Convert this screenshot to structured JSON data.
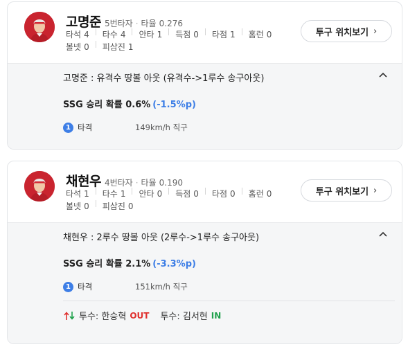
{
  "colors": {
    "accent_blue": "#3d7ee6",
    "out_red": "#e0302e",
    "in_green": "#1fa14c",
    "detail_bg": "#f5f6f7",
    "team_red": "#c9242f"
  },
  "players": [
    {
      "name": "고명준",
      "order": "5번타자",
      "avg_label": "타율",
      "avg": "0.276",
      "stats_row1": [
        {
          "label": "타석",
          "value": "4"
        },
        {
          "label": "타수",
          "value": "4"
        },
        {
          "label": "안타",
          "value": "1"
        },
        {
          "label": "득점",
          "value": "0"
        },
        {
          "label": "타점",
          "value": "1"
        },
        {
          "label": "홈런",
          "value": "0"
        }
      ],
      "stats_row2": [
        {
          "label": "볼넷",
          "value": "0"
        },
        {
          "label": "피삼진",
          "value": "1"
        }
      ],
      "pitch_button": "투구 위치보기",
      "play_desc": "고명준 : 유격수 땅볼 아웃 (유격수->1루수 송구아웃)",
      "prob_text": "SSG 승리 확률 0.6%",
      "prob_delta": "(-1.5%p)",
      "pitch_no": "1",
      "pitch_result": "타격",
      "pitch_info": "149km/h 직구"
    },
    {
      "name": "채현우",
      "order": "4번타자",
      "avg_label": "타율",
      "avg": "0.190",
      "stats_row1": [
        {
          "label": "타석",
          "value": "1"
        },
        {
          "label": "타수",
          "value": "1"
        },
        {
          "label": "안타",
          "value": "0"
        },
        {
          "label": "득점",
          "value": "0"
        },
        {
          "label": "타점",
          "value": "0"
        },
        {
          "label": "홈런",
          "value": "0"
        }
      ],
      "stats_row2": [
        {
          "label": "볼넷",
          "value": "0"
        },
        {
          "label": "피삼진",
          "value": "0"
        }
      ],
      "pitch_button": "투구 위치보기",
      "play_desc": "채현우 : 2루수 땅볼 아웃 (2루수->1루수 송구아웃)",
      "prob_text": "SSG 승리 확률 2.1%",
      "prob_delta": "(-3.3%p)",
      "pitch_no": "1",
      "pitch_result": "타격",
      "pitch_info": "151km/h 직구",
      "substitution": {
        "out_label": "투수: 한승혁",
        "out_tag": "OUT",
        "in_label": "투수: 김서현",
        "in_tag": "IN"
      }
    }
  ],
  "icons": {
    "avatar": "player-avatar",
    "collapse": "chevron-up-icon",
    "more": "chevron-right-icon",
    "swap": "swap-arrows-icon"
  }
}
